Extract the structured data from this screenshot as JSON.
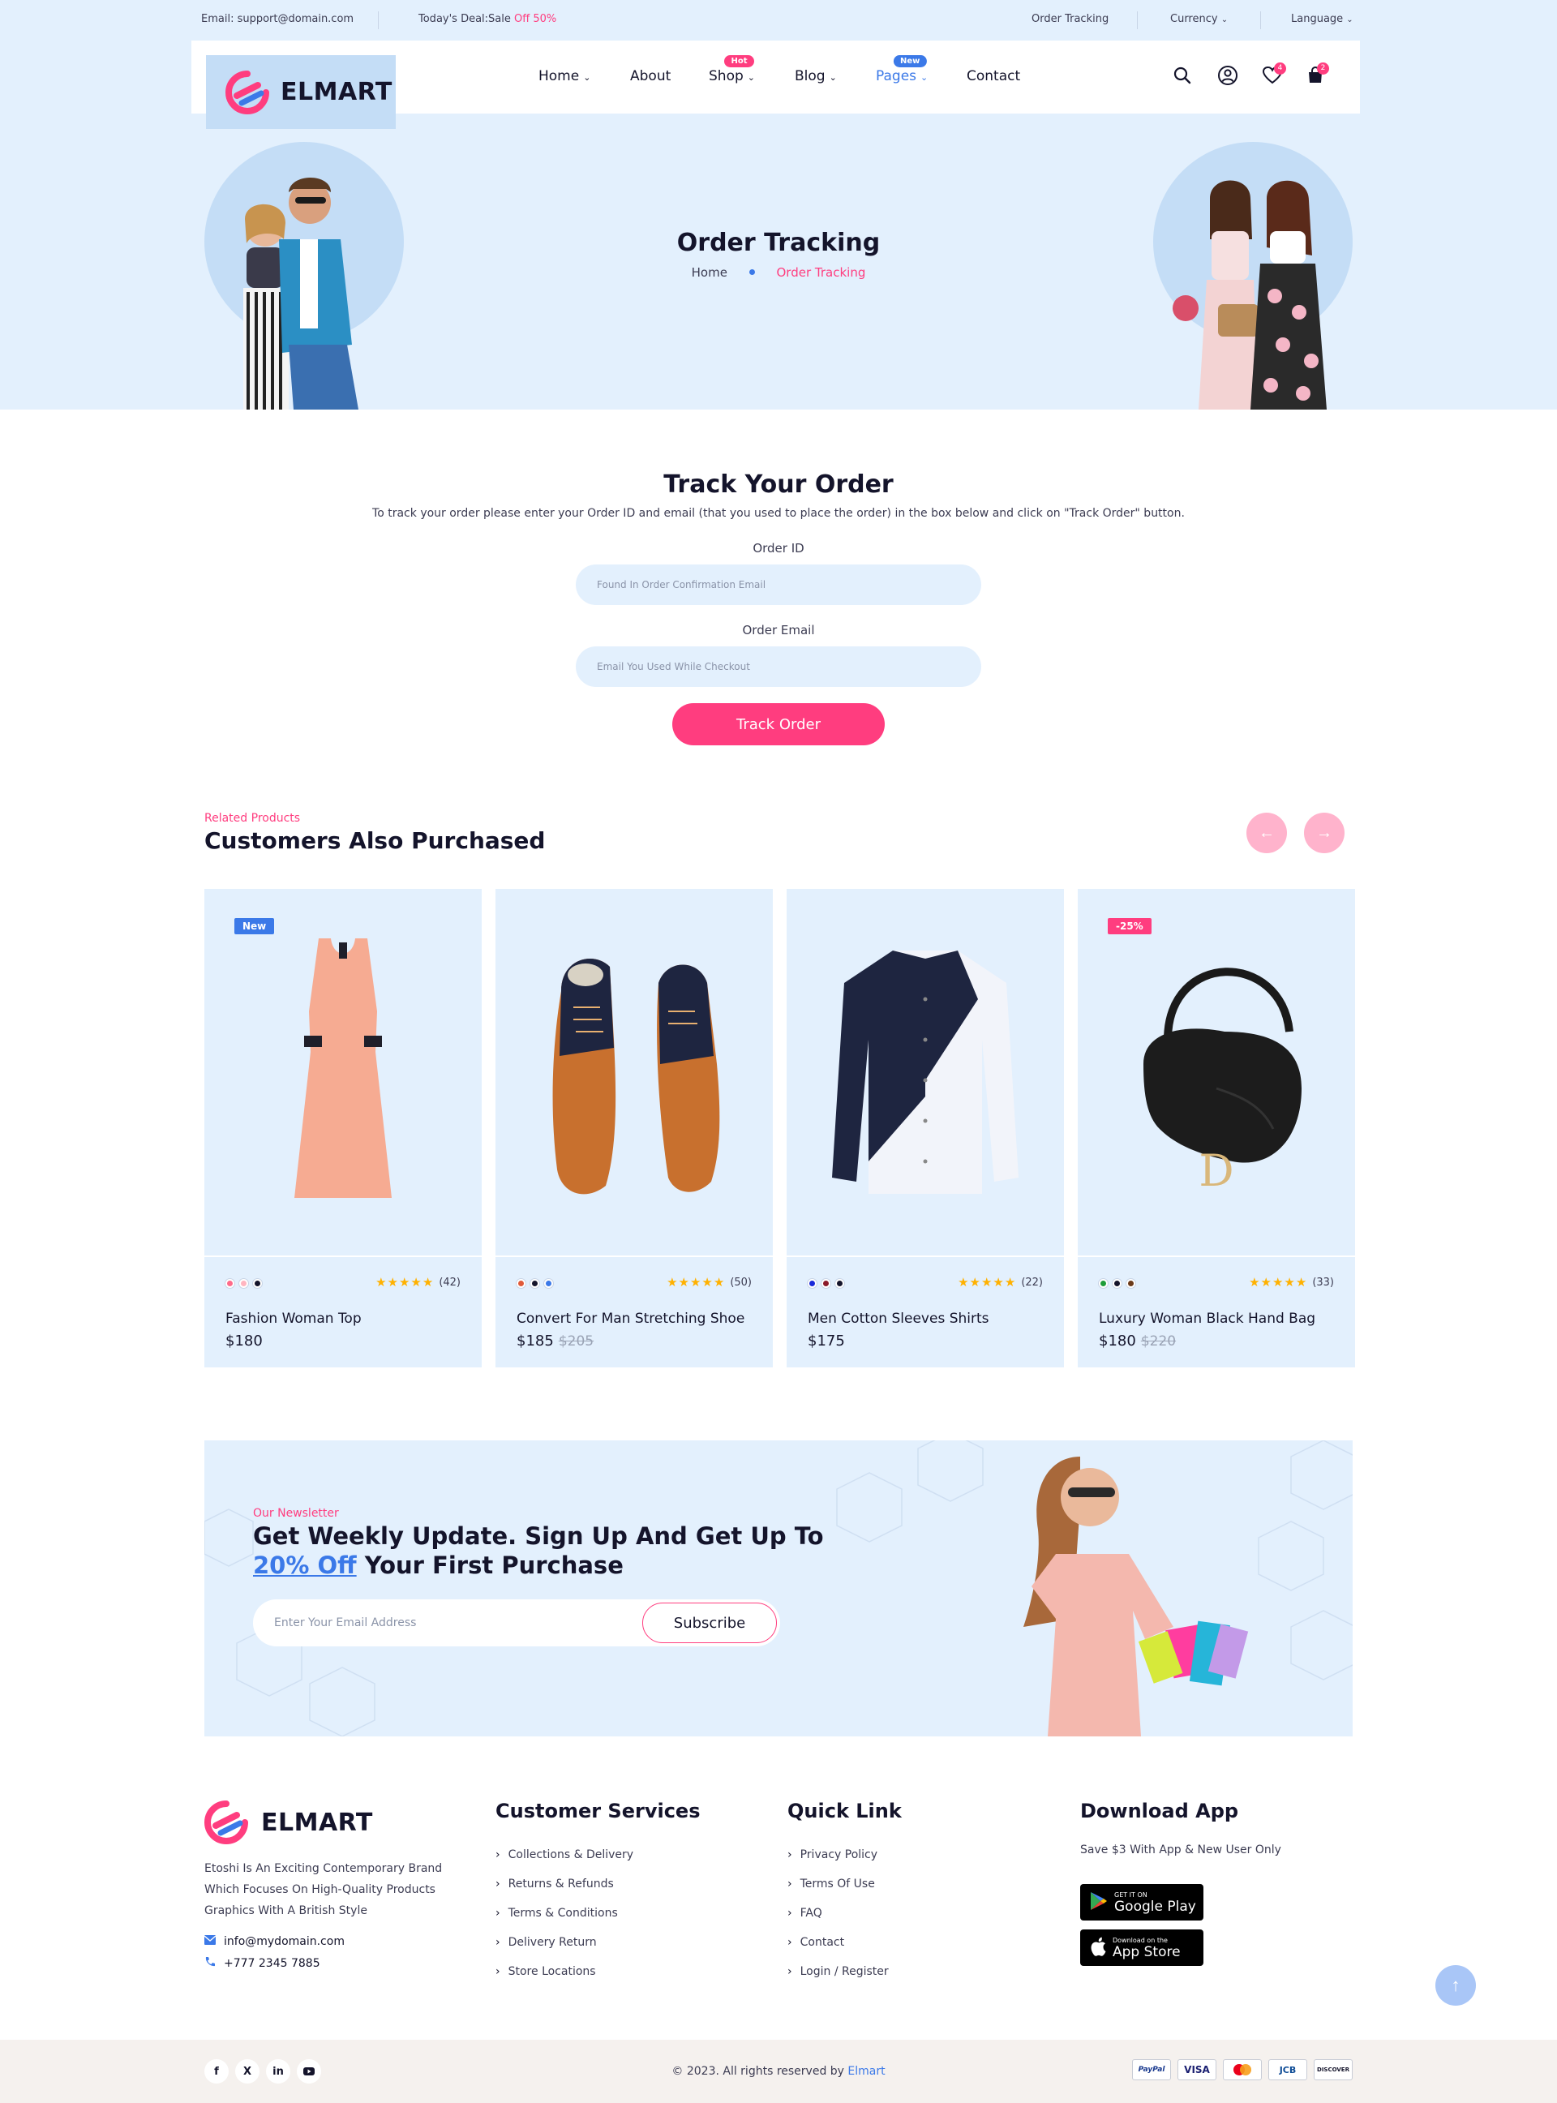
{
  "topbar": {
    "email": "Email: support@domain.com",
    "deal_prefix": "Today's Deal:Sale ",
    "deal_highlight": "Off 50%",
    "order_tracking": "Order Tracking",
    "currency": "Currency",
    "language": "Language"
  },
  "brand": {
    "name": "ELMART",
    "accent": "#ff3d7f",
    "secondary": "#3b79e8"
  },
  "nav": {
    "items": [
      {
        "label": "Home",
        "dropdown": true
      },
      {
        "label": "About",
        "dropdown": false
      },
      {
        "label": "Shop",
        "dropdown": true,
        "badge": "Hot"
      },
      {
        "label": "Blog",
        "dropdown": true
      },
      {
        "label": "Pages",
        "dropdown": true,
        "badge": "New",
        "active": true
      },
      {
        "label": "Contact",
        "dropdown": false
      }
    ],
    "icons": [
      "search-icon",
      "user-icon",
      "heart-icon",
      "cart-icon"
    ],
    "wishlist_count": "4",
    "cart_count": "2"
  },
  "page_header": {
    "title": "Order Tracking",
    "breadcrumb_home": "Home",
    "breadcrumb_current": "Order Tracking"
  },
  "track": {
    "title": "Track Your Order",
    "description": "To track your order please enter your Order ID and email (that you used to place the order) in the box below and click on \"Track Order\" button.",
    "order_id_label": "Order ID",
    "order_id_placeholder": "Found In Order Confirmation Email",
    "email_label": "Order Email",
    "email_placeholder": "Email You Used While Checkout",
    "button": "Track Order"
  },
  "related": {
    "subtitle": "Related Products",
    "title": "Customers Also Purchased",
    "prev_icon": "arrow-left-icon",
    "next_icon": "arrow-right-icon",
    "products": [
      {
        "name": "Fashion Woman Top",
        "price": "$180",
        "old_price": "",
        "badge": "New",
        "stars": "★★★★★",
        "reviews": "(42)",
        "swatches": [
          "#ff6b8a",
          "#ffb5c0",
          "#14142b"
        ]
      },
      {
        "name": "Convert For Man Stretching Shoe",
        "price": "$185",
        "old_price": "$205",
        "badge": "",
        "stars": "★★★★★",
        "reviews": "(50)",
        "swatches": [
          "#e05a3a",
          "#14142b",
          "#3b79e8"
        ]
      },
      {
        "name": "Men Cotton Sleeves Shirts",
        "price": "$175",
        "old_price": "",
        "badge": "",
        "stars": "★★★★★",
        "reviews": "(22)",
        "swatches": [
          "#1a2ad9",
          "#8b1a2a",
          "#14142b"
        ]
      },
      {
        "name": "Luxury Woman Black Hand Bag",
        "price": "$180",
        "old_price": "$220",
        "badge": "-25%",
        "stars": "★★★★★",
        "reviews": "(33)",
        "swatches": [
          "#1f9d3a",
          "#14142b",
          "#6b3a1a"
        ]
      }
    ]
  },
  "newsletter": {
    "subtitle": "Our Newsletter",
    "title_line1": "Get Weekly Update. Sign Up And Get Up To",
    "title_highlight": "20% Off",
    "title_rest": " Your First Purchase",
    "placeholder": "Enter Your Email Address",
    "button": "Subscribe"
  },
  "footer": {
    "about": "Etoshi Is An Exciting Contemporary Brand Which Focuses On High-Quality Products Graphics With A British Style",
    "email": "info@mydomain.com",
    "phone": "+777 2345 7885",
    "customer_services": {
      "title": "Customer Services",
      "links": [
        "Collections & Delivery",
        "Returns & Refunds",
        "Terms & Conditions",
        "Delivery Return",
        "Store Locations"
      ]
    },
    "quick_link": {
      "title": "Quick Link",
      "links": [
        "Privacy Policy",
        "Terms Of Use",
        "FAQ",
        "Contact",
        "Login / Register"
      ]
    },
    "download": {
      "title": "Download App",
      "text": "Save $3 With App & New User Only",
      "google_small": "GET IT ON",
      "google_big": "Google Play",
      "apple_small": "Download on the",
      "apple_big": "App Store"
    },
    "copyright_prefix": "© 2023. All rights reserved by ",
    "copyright_brand": "Elmart",
    "socials": [
      "facebook-icon",
      "x-icon",
      "linkedin-icon",
      "youtube-icon"
    ],
    "payments": [
      "PayPal",
      "VISA",
      "MC",
      "JCB",
      "DISCOVER"
    ]
  }
}
